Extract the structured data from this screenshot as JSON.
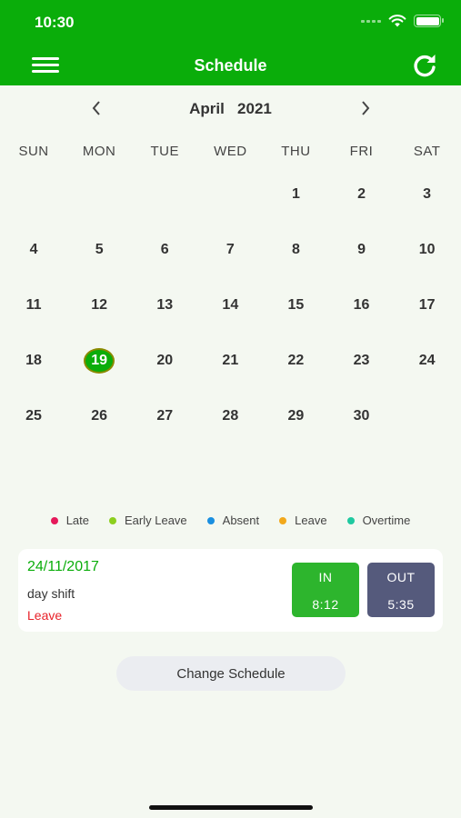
{
  "status_bar": {
    "time": "10:30"
  },
  "header": {
    "title": "Schedule",
    "menu_icon": "hamburger-menu-icon",
    "refresh_icon": "refresh-icon"
  },
  "calendar": {
    "month": "April",
    "year": "2021",
    "weekdays": [
      "SUN",
      "MON",
      "TUE",
      "WED",
      "THU",
      "FRI",
      "SAT"
    ],
    "days": [
      "",
      "",
      "",
      "",
      "1",
      "2",
      "3",
      "4",
      "5",
      "6",
      "7",
      "8",
      "9",
      "10",
      "11",
      "12",
      "13",
      "14",
      "15",
      "16",
      "17",
      "18",
      "19",
      "20",
      "21",
      "22",
      "23",
      "24",
      "25",
      "26",
      "27",
      "28",
      "29",
      "30",
      ""
    ],
    "selected_day": "19"
  },
  "legend": [
    {
      "label": "Late",
      "color": "#e5195a"
    },
    {
      "label": "Early Leave",
      "color": "#8ccf1e"
    },
    {
      "label": "Absent",
      "color": "#1a8fe0"
    },
    {
      "label": "Leave",
      "color": "#f2a81b"
    },
    {
      "label": "Overtime",
      "color": "#1fc9a0"
    }
  ],
  "record": {
    "date": "24/11/2017",
    "shift": "day shift",
    "status": "Leave",
    "in_label": "IN",
    "in_time": "8:12",
    "out_label": "OUT",
    "out_time": "5:35"
  },
  "change_schedule_label": "Change Schedule",
  "colors": {
    "primary": "#0aad0a",
    "out_box": "#555a7c",
    "status_leave": "#e8222a"
  }
}
